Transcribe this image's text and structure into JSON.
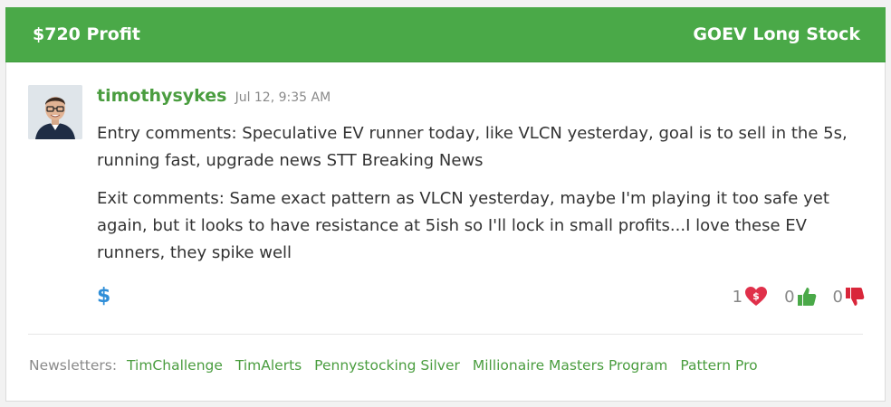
{
  "header": {
    "profit": "$720 Profit",
    "trade": "GOEV Long Stock"
  },
  "post": {
    "username": "timothysykes",
    "timestamp": "Jul 12, 9:35 AM",
    "entry_comment": "Entry comments: Speculative EV runner today, like VLCN yesterday, goal is to sell in the 5s, running fast, upgrade news STT Breaking News",
    "exit_comment": "Exit comments: Same exact pattern as VLCN yesterday, maybe I'm playing it too safe yet again, but it looks to have resistance at 5ish so I'll lock in small profits...I love these EV runners, they spike well",
    "dollar_icon": "$"
  },
  "reactions": {
    "heart_count": "1",
    "thumbs_up_count": "0",
    "thumbs_down_count": "0"
  },
  "newsletters": {
    "label": "Newsletters:",
    "items": [
      "TimChallenge",
      "TimAlerts",
      "Pennystocking Silver",
      "Millionaire Masters Program",
      "Pattern Pro"
    ]
  },
  "colors": {
    "header_green": "#4aa948",
    "link_green": "#4a9d3f",
    "dollar_blue": "#2f8ed8",
    "heart_red": "#e0304a"
  }
}
